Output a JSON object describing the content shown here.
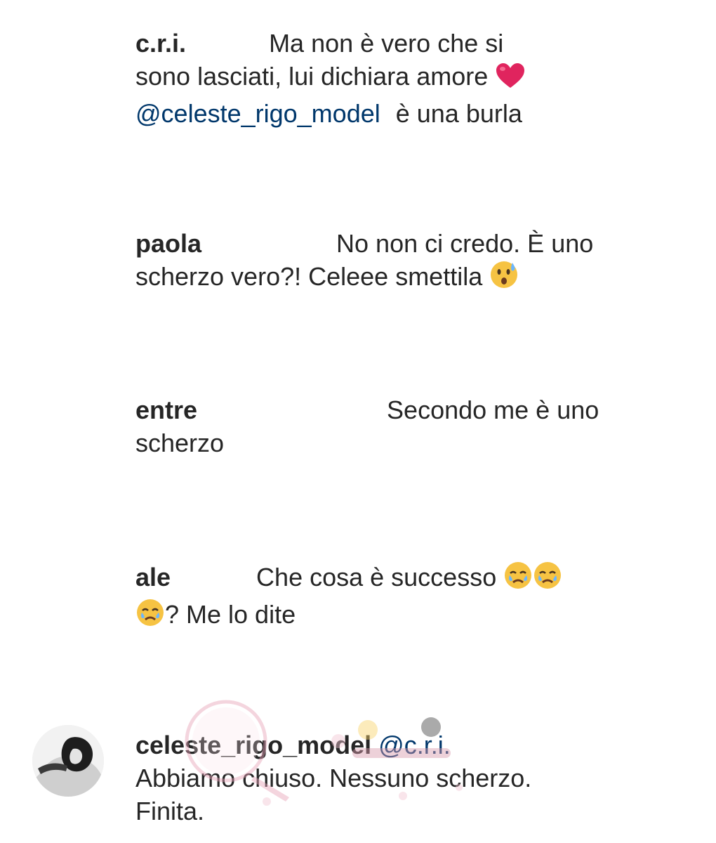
{
  "comments": [
    {
      "username": "c.r.i.",
      "text_line1": "Ma non è vero che si",
      "text_line2": "sono lasciati, lui dichiara amore",
      "mention": "@celeste_rigo_model",
      "text_line3": "è una burla",
      "emoji": "red-heart"
    },
    {
      "username": "paola",
      "text_line1": "No non ci credo. È uno",
      "text_line2": "scherzo vero?! Celeee smettila",
      "emoji": "anxious-face-with-sweat"
    },
    {
      "username": "entre",
      "text_line1": "Secondo me è uno",
      "text_line2": "scherzo"
    },
    {
      "username": "ale",
      "text_line1": "Che cosa è successo",
      "text_line2": "? Me lo dite",
      "emoji": "crying-face"
    }
  ],
  "reply": {
    "username": "celeste_rigo_model",
    "mention": "@c.r.i.",
    "text_line1": "Abbiamo chiuso. Nessuno scherzo.",
    "text_line2": "Finita."
  },
  "colors": {
    "text": "#262626",
    "mention": "#00376b",
    "heart": "#e0245e",
    "emoji_face": "#f6c343"
  }
}
